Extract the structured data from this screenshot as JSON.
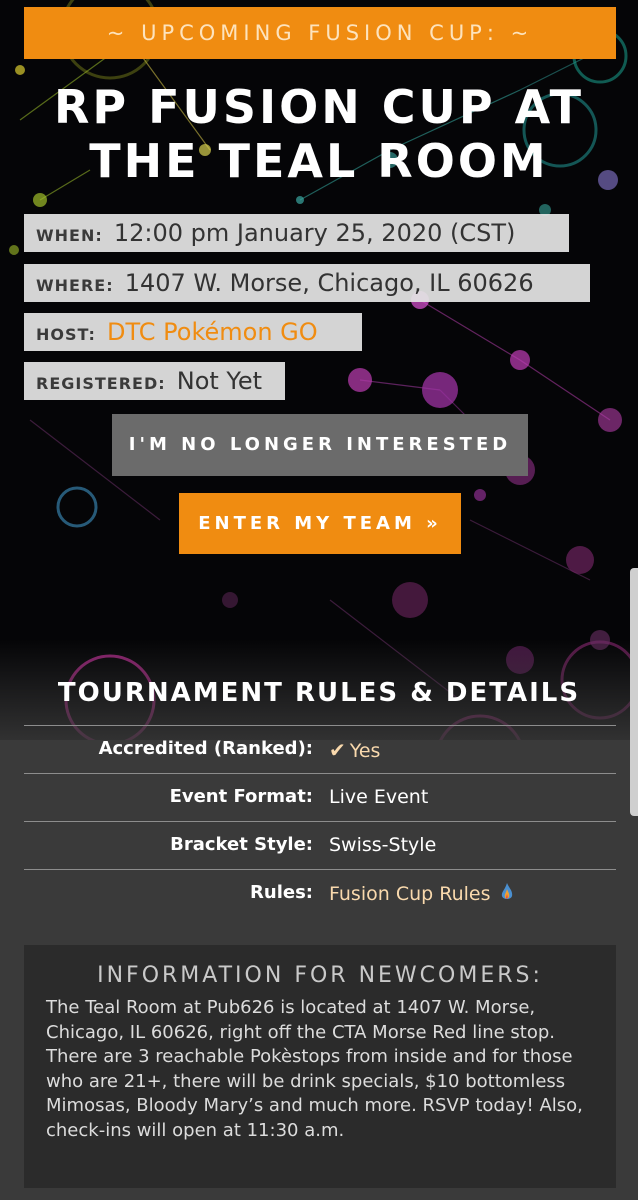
{
  "banner": {
    "label": "~ UPCOMING FUSION CUP: ~"
  },
  "event": {
    "title_line1": "RP FUSION CUP AT",
    "title_line2": "THE TEAL ROOM",
    "when_label": "WHEN:",
    "when_value": "12:00 pm January 25, 2020 (CST)",
    "where_label": "WHERE:",
    "where_value": "1407 W. Morse, Chicago, IL 60626",
    "host_label": "HOST:",
    "host_value": "DTC Pokémon GO",
    "registered_label": "REGISTERED:",
    "registered_value": "Not Yet"
  },
  "actions": {
    "not_interested": "I'M NO LONGER INTERESTED",
    "enter_team": "ENTER MY TEAM »"
  },
  "rules": {
    "title": "TOURNAMENT RULES & DETAILS",
    "rows": [
      {
        "key": "Accredited (Ranked):",
        "value": "Yes"
      },
      {
        "key": "Event Format:",
        "value": "Live Event"
      },
      {
        "key": "Bracket Style:",
        "value": "Swiss-Style"
      },
      {
        "key": "Rules:",
        "value": "Fusion Cup Rules"
      }
    ]
  },
  "newcomers": {
    "title": "INFORMATION FOR NEWCOMERS:",
    "body": "The Teal Room at Pub626 is located at 1407 W. Morse, Chicago, IL 60626, right off the CTA Morse Red line stop. There are 3 reachable Pokèstops from inside and for those who are 21+, there will be drink specials, $10 bottomless Mimosas, Bloody Mary’s and much more. RSVP today! Also, check-ins will open at 11:30 a.m."
  },
  "colors": {
    "accent": "#f08c11",
    "accent_light": "#f9d9ad",
    "panel_bg": "#2b2b2b",
    "page_bg": "#3a3a3a"
  },
  "icons": {
    "check": "check-icon",
    "rules_link": "flame-icon"
  }
}
